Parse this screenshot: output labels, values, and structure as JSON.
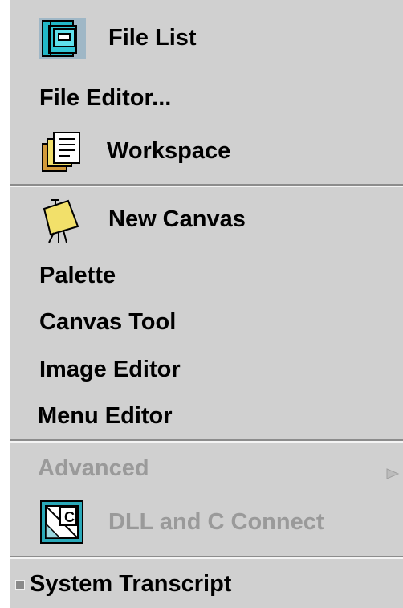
{
  "menu": {
    "items": [
      {
        "label": "File List",
        "icon": "file-list-icon"
      },
      {
        "label": "File Editor..."
      },
      {
        "label": "Workspace",
        "icon": "workspace-icon"
      },
      {
        "label": "New Canvas",
        "icon": "new-canvas-icon"
      },
      {
        "label": "Palette"
      },
      {
        "label": "Canvas Tool"
      },
      {
        "label": "Image Editor"
      },
      {
        "label": "Menu Editor"
      },
      {
        "label": "Advanced",
        "disabled": true,
        "icon": "submenu-arrow-icon"
      },
      {
        "label": "DLL and C Connect",
        "disabled": true,
        "icon": "dll-c-connect-icon"
      },
      {
        "label": "System Transcript",
        "icon": "checkbox-indicator-icon"
      }
    ]
  },
  "colors": {
    "menu_bg": "#d0d0d0",
    "disabled_text": "#9a9a9a",
    "icon_cyan": "#22b8c8",
    "icon_yellow": "#f2e06a"
  }
}
